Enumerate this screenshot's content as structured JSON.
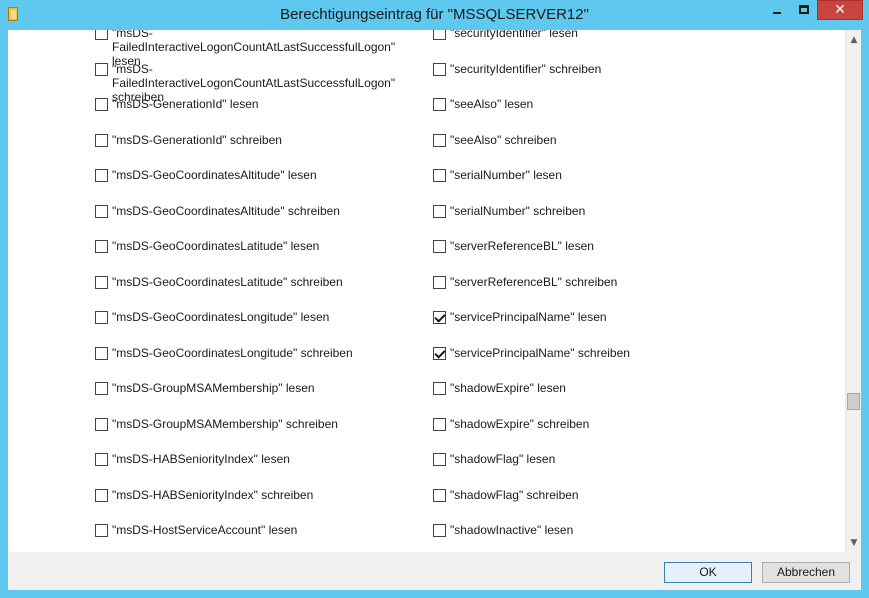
{
  "window": {
    "title": "Berechtigungseintrag für \"MSSQLSERVER12\"",
    "close_glyph": "✕",
    "icons": {
      "app": "folder-icon",
      "minimize": "minimize-icon",
      "maximize": "maximize-icon",
      "close": "close-icon"
    },
    "colors": {
      "frame": "#5ec8ee",
      "close_button": "#c7453e",
      "client": "#f0f0f0",
      "list_bg": "#ffffff"
    }
  },
  "permissions": {
    "left": [
      {
        "label": "\"msDS-FailedInteractiveLogonCountAtLastSuccessfulLogon\" lesen",
        "checked": false
      },
      {
        "label": "\"msDS-FailedInteractiveLogonCountAtLastSuccessfulLogon\" schreiben",
        "checked": false
      },
      {
        "label": "\"msDS-GenerationId\" lesen",
        "checked": false
      },
      {
        "label": "\"msDS-GenerationId\" schreiben",
        "checked": false
      },
      {
        "label": "\"msDS-GeoCoordinatesAltitude\" lesen",
        "checked": false
      },
      {
        "label": "\"msDS-GeoCoordinatesAltitude\" schreiben",
        "checked": false
      },
      {
        "label": "\"msDS-GeoCoordinatesLatitude\" lesen",
        "checked": false
      },
      {
        "label": "\"msDS-GeoCoordinatesLatitude\" schreiben",
        "checked": false
      },
      {
        "label": "\"msDS-GeoCoordinatesLongitude\" lesen",
        "checked": false
      },
      {
        "label": "\"msDS-GeoCoordinatesLongitude\" schreiben",
        "checked": false
      },
      {
        "label": "\"msDS-GroupMSAMembership\" lesen",
        "checked": false
      },
      {
        "label": "\"msDS-GroupMSAMembership\" schreiben",
        "checked": false
      },
      {
        "label": "\"msDS-HABSeniorityIndex\" lesen",
        "checked": false
      },
      {
        "label": "\"msDS-HABSeniorityIndex\" schreiben",
        "checked": false
      },
      {
        "label": "\"msDS-HostServiceAccount\" lesen",
        "checked": false
      }
    ],
    "right": [
      {
        "label": "\"securityIdentifier\" lesen",
        "checked": false
      },
      {
        "label": "\"securityIdentifier\" schreiben",
        "checked": false
      },
      {
        "label": "\"seeAlso\" lesen",
        "checked": false
      },
      {
        "label": "\"seeAlso\" schreiben",
        "checked": false
      },
      {
        "label": "\"serialNumber\" lesen",
        "checked": false
      },
      {
        "label": "\"serialNumber\" schreiben",
        "checked": false
      },
      {
        "label": "\"serverReferenceBL\" lesen",
        "checked": false
      },
      {
        "label": "\"serverReferenceBL\" schreiben",
        "checked": false
      },
      {
        "label": "\"servicePrincipalName\" lesen",
        "checked": true
      },
      {
        "label": "\"servicePrincipalName\" schreiben",
        "checked": true
      },
      {
        "label": "\"shadowExpire\" lesen",
        "checked": false
      },
      {
        "label": "\"shadowExpire\" schreiben",
        "checked": false
      },
      {
        "label": "\"shadowFlag\" lesen",
        "checked": false
      },
      {
        "label": "\"shadowFlag\" schreiben",
        "checked": false
      },
      {
        "label": "\"shadowInactive\" lesen",
        "checked": false
      }
    ]
  },
  "scrollbar": {
    "up_glyph": "▲",
    "down_glyph": "▼",
    "position": 0.7
  },
  "buttons": {
    "ok_label": "OK",
    "cancel_label": "Abbrechen"
  }
}
